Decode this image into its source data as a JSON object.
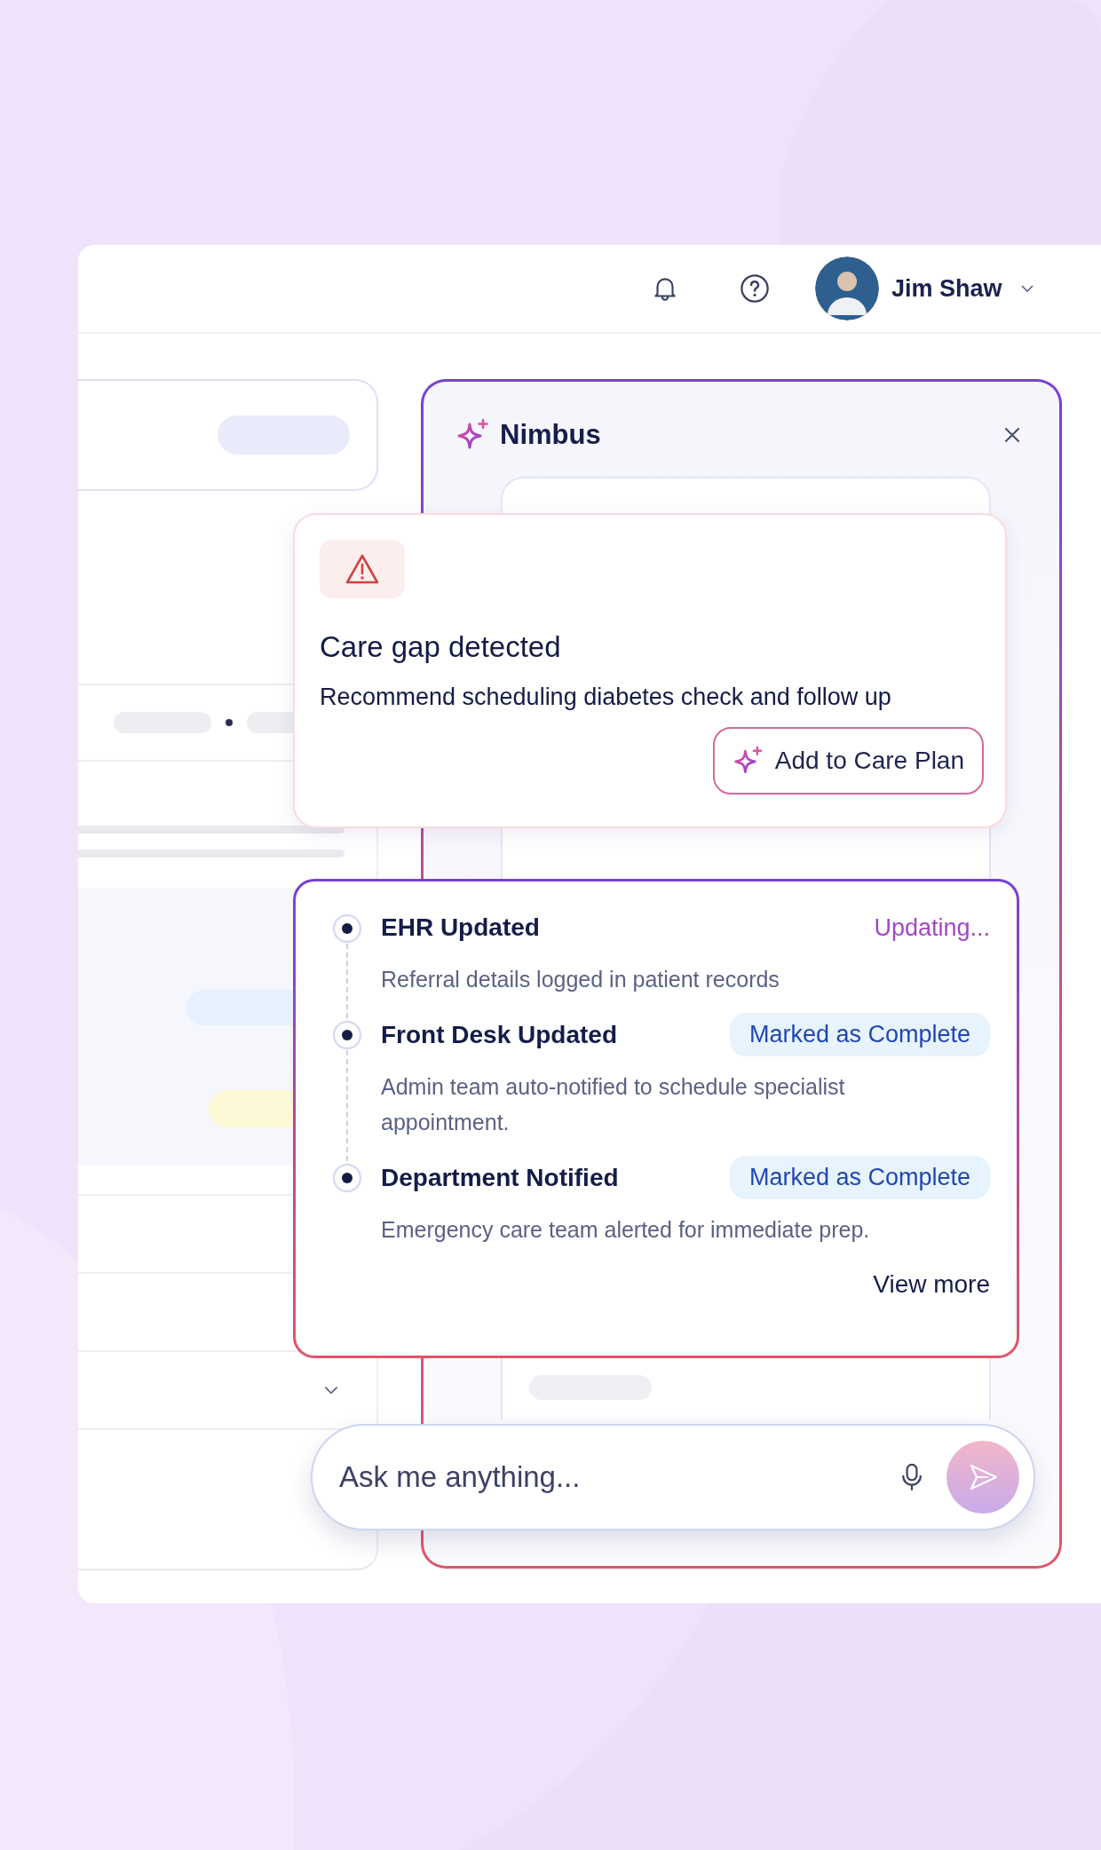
{
  "header": {
    "user_name": "Jim Shaw"
  },
  "assistant": {
    "title": "Nimbus"
  },
  "alert": {
    "title": "Care gap detected",
    "message": "Recommend scheduling diabetes check and follow up",
    "action": "Add to Care Plan"
  },
  "timeline": {
    "items": [
      {
        "title": "EHR Updated",
        "status": "Updating...",
        "kind": "progress",
        "description": "Referral details logged in patient records"
      },
      {
        "title": "Front Desk Updated",
        "status": "Marked as Complete",
        "kind": "done",
        "description": "Admin team auto-notified to schedule specialist appointment."
      },
      {
        "title": "Department Notified",
        "status": "Marked as Complete",
        "kind": "done",
        "description": "Emergency care team alerted for immediate prep."
      }
    ],
    "link": "View more"
  },
  "chat": {
    "placeholder": "Ask me anything..."
  }
}
